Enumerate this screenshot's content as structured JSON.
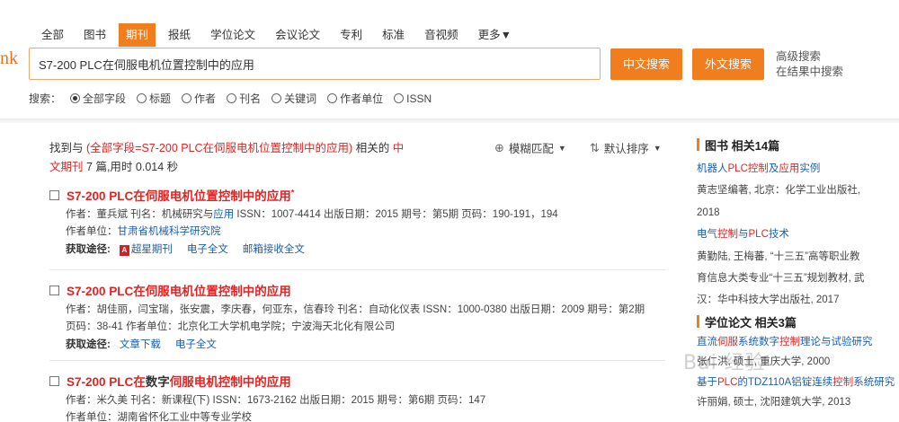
{
  "logo": {
    "text": "nk"
  },
  "tabs": [
    {
      "label": "全部",
      "active": false
    },
    {
      "label": "图书",
      "active": false
    },
    {
      "label": "期刊",
      "active": true
    },
    {
      "label": "报纸",
      "active": false
    },
    {
      "label": "学位论文",
      "active": false
    },
    {
      "label": "会议论文",
      "active": false
    },
    {
      "label": "专利",
      "active": false
    },
    {
      "label": "标准",
      "active": false
    },
    {
      "label": "音视频",
      "active": false
    },
    {
      "label": "更多▼",
      "active": false
    }
  ],
  "search": {
    "value": "S7-200 PLC在伺服电机位置控制中的应用"
  },
  "buttons": {
    "cn_search": "中文搜索",
    "foreign_search": "外文搜索"
  },
  "adv": {
    "advanced": "高级搜索",
    "within": "在结果中搜索"
  },
  "fields": {
    "label": "搜索：",
    "options": [
      "全部字段",
      "标题",
      "作者",
      "刊名",
      "关键词",
      "作者单位",
      "ISSN"
    ],
    "selected": "全部字段"
  },
  "summary": {
    "prefix": "找到与",
    "query": "(全部字段=S7-200 PLC在伺服电机位置控制中的应用)",
    "mid": "相关的",
    "scope_part1": "中",
    "scope_part2": "文期刊",
    "count": "7",
    "count_suffix": "篇,用时",
    "time": "0.014",
    "time_unit": "秒"
  },
  "sort": {
    "fuzzy": "模糊匹配",
    "default": "默认排序"
  },
  "results": [
    {
      "title": "S7-200 PLC在伺服电机位置控制中的应用",
      "star": "*",
      "meta1_a": "作者：董兵斌  刊名：机械研究与",
      "meta1_b": "应用",
      "meta1_c": "  ISSN：1007-4414  出版日期：2015  期号：第5期  页码：190-191，194",
      "meta2_a": "作者单位：",
      "meta2_b": "甘肃省机械科学研究院",
      "access_label": "获取途径:",
      "links": [
        "超星期刊",
        "电子全文",
        "邮箱接收全文"
      ]
    },
    {
      "title": "S7-200 PLC在伺服电机位置控制中的应用",
      "meta1": "作者：胡佳丽，闫宝瑞，张安震，李庆春，何亚东，信春玲  刊名：自动化仪表  ISSN：1000-0380  出版日期：2009  期号：第2期",
      "meta2": "页码：38-41  作者单位：北京化工大学机电学院；宁波海天北化有限公司",
      "access_label": "获取途径:",
      "links": [
        "文章下载",
        "电子全文"
      ]
    },
    {
      "title_red1": "S7-200 PLC在",
      "title_black": "数字",
      "title_red2": "伺服电机控制中的应用",
      "meta1": "作者：米久美  刊名：新课程(下)  ISSN：1673-2162  出版日期：2015  期号：第6期  页码：147",
      "meta2": "作者单位：湖南省怀化工业中等专业学校"
    }
  ],
  "sidebar": {
    "books_head": "图书  相关14篇",
    "book1_title_a": "机器人",
    "book1_title_b": "PLC控制",
    "book1_title_c": "及",
    "book1_title_d": "应用",
    "book1_title_e": "实例",
    "book1_info1": "黄志坚编著, 北京：化学工业出版社,",
    "book1_info2": "2018",
    "book2_title_a": "电气",
    "book2_title_b": "控制",
    "book2_title_c": "与",
    "book2_title_d": "PLC",
    "book2_title_e": "技术",
    "book2_info1": "黄勤陆, 王梅蕃, “十三五”高等职业教",
    "book2_info2": "育信息大类专业“十三五”规划教材, 武",
    "book2_info3": "汉：华中科技大学出版社, 2017",
    "thesis_head": "学位论文  相关3篇",
    "thesis1_a": "直流",
    "thesis1_b": "伺服",
    "thesis1_c": "系统数字",
    "thesis1_d": "控制",
    "thesis1_e": "理论与试验研究",
    "thesis1_info": "张仁洪, 硕士, 重庆大学, 2000",
    "thesis2_a": "基于",
    "thesis2_b": "PLC",
    "thesis2_c": "的TDZ110A铝锭连续",
    "thesis2_d": "控制",
    "thesis2_e": "系统研究",
    "thesis2_info": "许丽娟, 硕士, 沈阳建筑大学, 2013"
  },
  "watermark": {
    "text": "Bai 经验"
  }
}
